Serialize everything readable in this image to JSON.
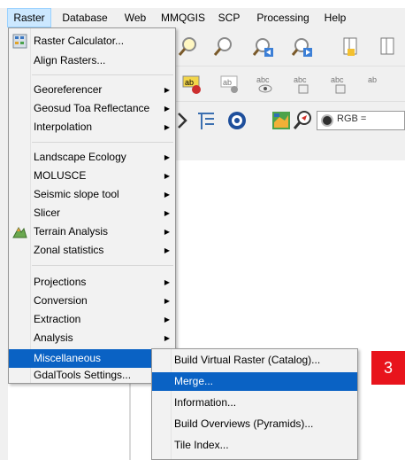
{
  "menubar": {
    "items": [
      {
        "label": "Raster",
        "active": true
      },
      {
        "label": "Database",
        "active": false
      },
      {
        "label": "Web",
        "active": false
      },
      {
        "label": "MMQGIS",
        "active": false
      },
      {
        "label": "SCP",
        "active": false
      },
      {
        "label": "Processing",
        "active": false
      },
      {
        "label": "Help",
        "active": false
      }
    ]
  },
  "raster_menu": {
    "items": [
      {
        "label": "Raster Calculator...",
        "icon": "raster-calculator-icon",
        "submenu": false
      },
      {
        "label": "Align Rasters...",
        "submenu": false
      },
      {
        "label": "Georeferencer",
        "submenu": true
      },
      {
        "label": "Geosud Toa Reflectance",
        "submenu": true
      },
      {
        "label": "Interpolation",
        "submenu": true
      },
      {
        "label": "Landscape Ecology",
        "submenu": true
      },
      {
        "label": "MOLUSCE",
        "submenu": true
      },
      {
        "label": "Seismic slope tool",
        "submenu": true
      },
      {
        "label": "Slicer",
        "submenu": true
      },
      {
        "label": "Terrain Analysis",
        "icon": "terrain-analysis-icon",
        "submenu": true
      },
      {
        "label": "Zonal statistics",
        "submenu": true
      },
      {
        "label": "Projections",
        "submenu": true
      },
      {
        "label": "Conversion",
        "submenu": true
      },
      {
        "label": "Extraction",
        "submenu": true
      },
      {
        "label": "Analysis",
        "submenu": true
      },
      {
        "label": "Miscellaneous",
        "submenu": true,
        "highlighted": true
      },
      {
        "label": "GdalTools Settings...",
        "submenu": false
      }
    ]
  },
  "misc_submenu": {
    "items": [
      {
        "label": "Build Virtual Raster (Catalog)...",
        "highlighted": false
      },
      {
        "label": "Merge...",
        "highlighted": true
      },
      {
        "label": "Information...",
        "highlighted": false
      },
      {
        "label": "Build Overviews (Pyramids)...",
        "highlighted": false
      },
      {
        "label": "Tile Index...",
        "highlighted": false
      }
    ]
  },
  "toolbar": {
    "rgb_label": "RGB ="
  },
  "annotation": {
    "step_number": "3"
  },
  "colors": {
    "highlight": "#0a62c4",
    "badge": "#e8141c",
    "menubar_active": "#cce8ff"
  }
}
